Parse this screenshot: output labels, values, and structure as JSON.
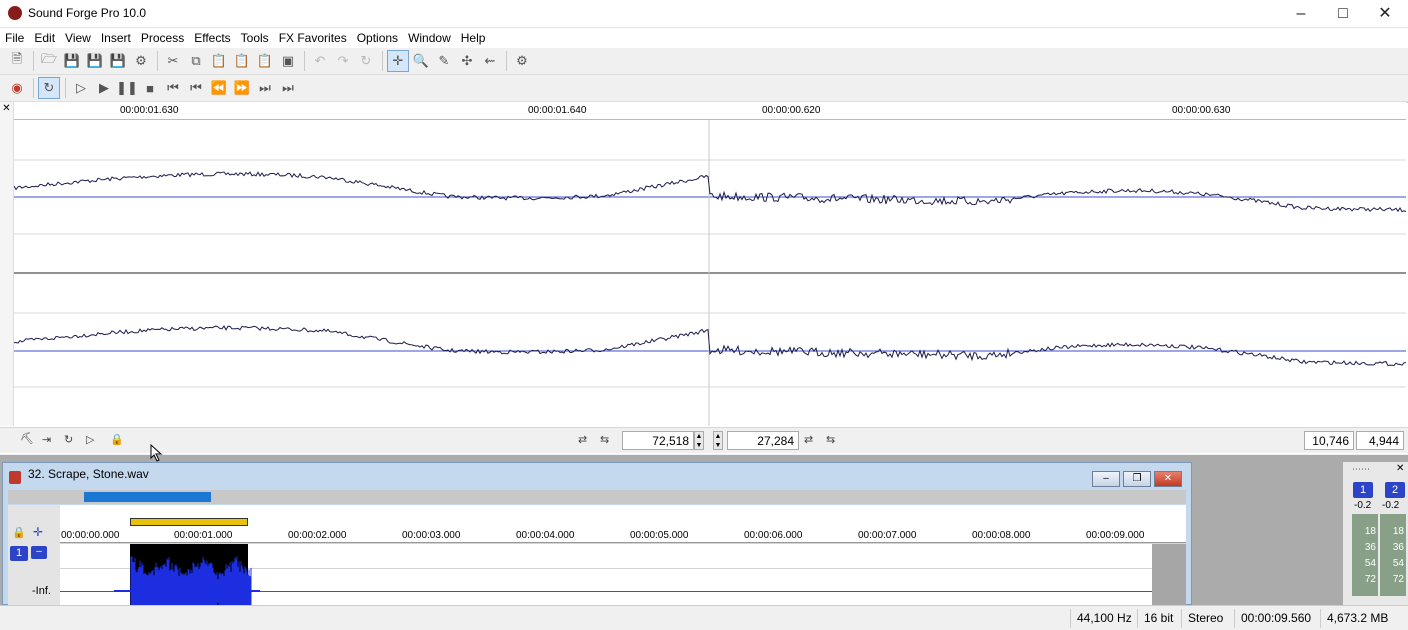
{
  "window": {
    "title": "Sound Forge Pro 10.0"
  },
  "menu": [
    "File",
    "Edit",
    "View",
    "Insert",
    "Process",
    "Effects",
    "Tools",
    "FX Favorites",
    "Options",
    "Window",
    "Help"
  ],
  "icons": {
    "toolbar1": [
      "new-file-icon",
      "open-folder-icon",
      "save-icon",
      "save-as-icon",
      "save-all-icon",
      "render-icon",
      "cut-icon",
      "copy-icon",
      "paste-icon",
      "paste-special-icon",
      "mix-icon",
      "crop-icon",
      "undo-icon",
      "redo-icon",
      "repeat-icon",
      "edit-tool-icon",
      "magnify-tool-icon",
      "pencil-tool-icon",
      "envelope-tool-icon",
      "event-tool-icon",
      "plugin-chainer-icon"
    ],
    "toolbar2": [
      "record-icon",
      "loop-icon",
      "play-all-icon",
      "play-icon",
      "pause-icon",
      "stop-icon",
      "go-to-start-icon",
      "previous-marker-icon",
      "rewind-icon",
      "fast-forward-icon",
      "next-marker-icon",
      "go-to-end-icon"
    ]
  },
  "ruler": {
    "labels": [
      "00:00:01.630",
      "00:00:01.640",
      "00:00:00.620",
      "00:00:00.630"
    ]
  },
  "bottombar": {
    "zoom_left": "72,518",
    "zoom_right": "27,284",
    "right_a": "10,746",
    "right_b": "4,944"
  },
  "subwindow": {
    "title": "32. Scrape, Stone.wav",
    "ruler_labels": [
      "00:00:00.000",
      "00:00:01.000",
      "00:00:02.000",
      "00:00:03.000",
      "00:00:04.000",
      "00:00:05.000",
      "00:00:06.000",
      "00:00:07.000",
      "00:00:08.000",
      "00:00:09.000"
    ],
    "channel_btn": "1",
    "level": "-Inf."
  },
  "meters": {
    "ch1": "1",
    "ch2": "2",
    "peak1": "-0.2",
    "peak2": "-0.2",
    "scale": [
      "18",
      "36",
      "54",
      "72"
    ]
  },
  "status": {
    "rate": "44,100 Hz",
    "bits": "16 bit",
    "channels": "Stereo",
    "length": "00:00:09.560",
    "disk": "4,673.2 MB"
  }
}
